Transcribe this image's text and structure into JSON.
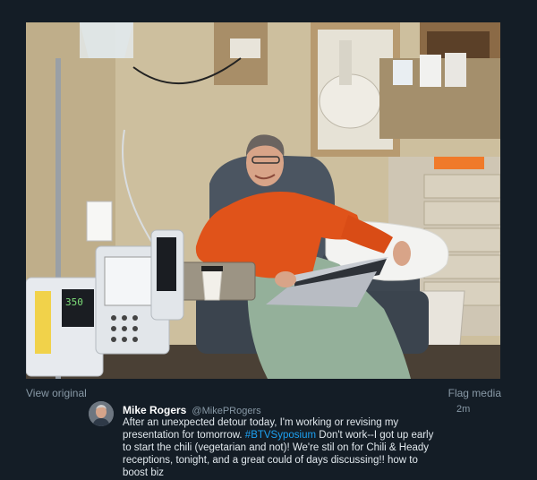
{
  "media": {
    "alt": "Man in orange shirt seated in infusion chair with laptop, IV pumps beside him",
    "view_original": "View original",
    "flag_media": "Flag media",
    "pump_display": "350"
  },
  "tweet": {
    "author_name": "Mike Rogers",
    "author_handle": "@MikePRogers",
    "time": "2m",
    "text_before": "After an unexpected detour today, I'm working or revising my presentation for tomorrow. ",
    "hashtag": "#BTVSyposium",
    "text_after": " Don't work--I got up early to start the chili (vegetarian and not)! We're stil on for Chili & Heady receptions, tonight, and a great could of days discussing!! how to boost biz"
  },
  "colors": {
    "background": "#141d26",
    "link": "#1da1f2",
    "muted": "#8899a6",
    "shirt": "#e0531a"
  }
}
